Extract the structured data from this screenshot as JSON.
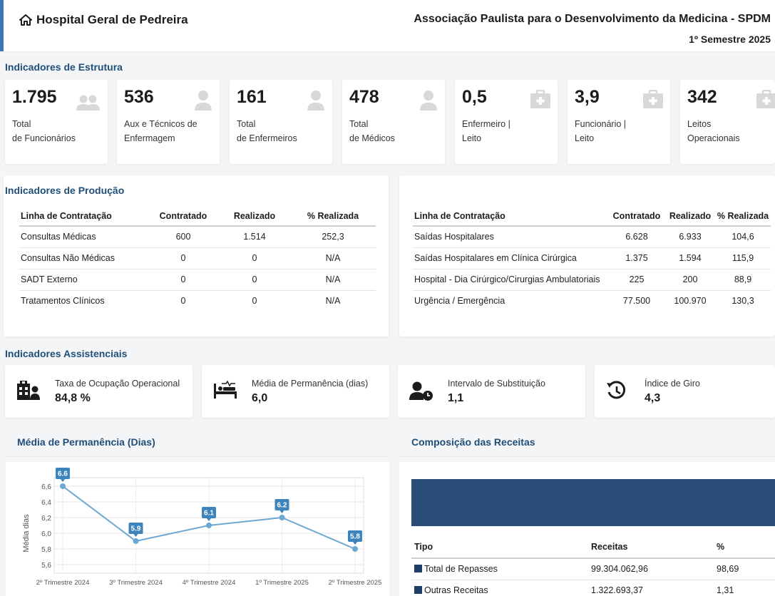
{
  "header": {
    "hospital": "Hospital Geral de Pedreira",
    "organization": "Associação Paulista para o Desenvolvimento da Medicina - SPDM",
    "semester": "1º Semestre 2025"
  },
  "estrutura": {
    "title": "Indicadores de Estrutura",
    "kpis": [
      {
        "value": "1.795",
        "label": "Total\nde Funcionários",
        "icon": "users-icon"
      },
      {
        "value": "536",
        "label": "Aux e Técnicos de\nEnfermagem",
        "icon": "user-icon"
      },
      {
        "value": "161",
        "label": "Total\nde Enfermeiros",
        "icon": "user-icon"
      },
      {
        "value": "478",
        "label": "Total\nde Médicos",
        "icon": "user-icon"
      },
      {
        "value": "0,5",
        "label": "Enfermeiro |\nLeito",
        "icon": "medical-kit-icon"
      },
      {
        "value": "3,9",
        "label": "Funcionário |\nLeito",
        "icon": "medical-kit-icon"
      },
      {
        "value": "342",
        "label": "Leitos\nOperacionais",
        "icon": "medical-kit-icon"
      }
    ]
  },
  "producao": {
    "title": "Indicadores de Produção",
    "headers": [
      "Linha de Contratação",
      "Contratado",
      "Realizado",
      "% Realizada"
    ],
    "left_rows": [
      [
        "Consultas Médicas",
        "600",
        "1.514",
        "252,3"
      ],
      [
        "Consultas Não Médicas",
        "0",
        "0",
        "N/A"
      ],
      [
        "SADT Externo",
        "0",
        "0",
        "N/A"
      ],
      [
        "Tratamentos Clínicos",
        "0",
        "0",
        "N/A"
      ]
    ],
    "right_rows": [
      [
        "Saídas Hospitalares",
        "6.628",
        "6.933",
        "104,6"
      ],
      [
        "Saídas Hospitalares em Clínica Cirúrgica",
        "1.375",
        "1.594",
        "115,9"
      ],
      [
        "Hospital - Dia Cirúrgico/Cirurgias Ambulatoriais",
        "225",
        "200",
        "88,9"
      ],
      [
        "Urgência / Emergência",
        "77.500",
        "100.970",
        "130,3"
      ]
    ]
  },
  "assistenciais": {
    "title": "Indicadores Assistenciais",
    "cards": [
      {
        "label": "Taxa de Ocupação Operacional",
        "value": "84,8 %",
        "icon": "hospital-building-icon"
      },
      {
        "label": "Média de Permanência (dias)",
        "value": "6,0",
        "icon": "hospital-bed-icon"
      },
      {
        "label": "Intervalo de Substituição",
        "value": "1,1",
        "icon": "user-clock-icon"
      },
      {
        "label": "Índice de Giro",
        "value": "4,3",
        "icon": "history-icon"
      }
    ]
  },
  "media_title": "Média de Permanência (Dias)",
  "receitas": {
    "title": "Composição das Receitas",
    "headers": [
      "Tipo",
      "Receitas",
      "%"
    ],
    "rows": [
      [
        "Total de Repasses",
        "99.304.062,96",
        "98,69"
      ],
      [
        "Outras Receitas",
        "1.322.693,37",
        "1,31"
      ]
    ],
    "band_color": "#2a4d78"
  },
  "chart_data": {
    "type": "line",
    "title": "",
    "xlabel": "",
    "ylabel": "Média dias",
    "categories": [
      "2º Trimestre 2024",
      "3º Trimestre 2024",
      "4º Trimestre 2024",
      "1º Trimestre 2025",
      "2º Trimestre 2025"
    ],
    "series": [
      {
        "values": [
          6.6,
          5.9,
          6.1,
          6.2,
          5.8
        ]
      }
    ],
    "data_labels": [
      "6.6",
      "5.9",
      "6.1",
      "6.2",
      "5.8"
    ],
    "yticks": [
      "5,6",
      "5,8",
      "6,0",
      "6,2",
      "6,4",
      "6,6"
    ],
    "ylim": [
      5.6,
      6.6
    ],
    "grid": true,
    "line_color": "#6ba8d4",
    "label_color": "#3d84bc"
  }
}
